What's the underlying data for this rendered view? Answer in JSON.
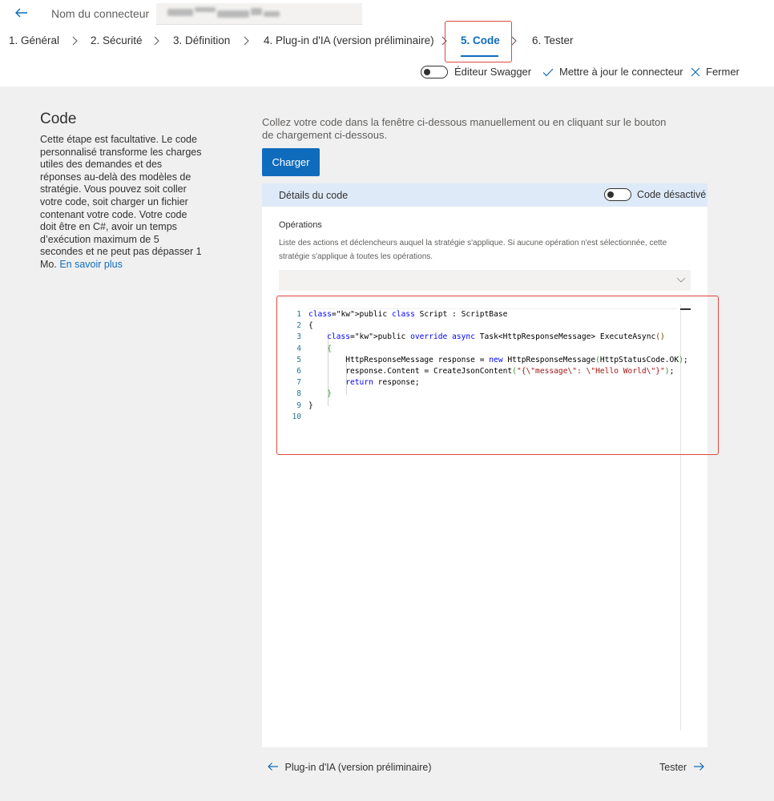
{
  "header": {
    "connector_label": "Nom du connecteur",
    "steps": [
      {
        "label": "1. Général"
      },
      {
        "label": "2. Sécurité"
      },
      {
        "label": "3. Définition"
      },
      {
        "label": "4. Plug-in d'IA (version préliminaire)"
      },
      {
        "label": "5. Code",
        "active": true
      },
      {
        "label": "6. Tester"
      }
    ],
    "actions": {
      "swagger_label": "Éditeur Swagger",
      "update_label": "Mettre à jour le connecteur",
      "close_label": "Fermer"
    }
  },
  "left": {
    "title": "Code",
    "description": "Cette étape est facultative. Le code personnalisé transforme les charges utiles des demandes et des réponses au-delà des modèles de stratégie. Vous pouvez soit coller votre code, soit charger un fichier contenant votre code. Votre code doit être en C#, avoir un temps d’exécution maximum de 5 secondes et ne peut pas dépasser 1 Mo.",
    "learn_more": "En savoir plus"
  },
  "main": {
    "intro": "Collez votre code dans la fenêtre ci-dessous manuellement ou en cliquant sur le bouton de chargement ci-dessous.",
    "upload_label": "Charger",
    "panel_title": "Détails du code",
    "code_toggle_label": "Code désactivé",
    "operations_title": "Opérations",
    "operations_desc": "Liste des actions et déclencheurs auquel la stratégie s'applique. Si aucune opération n'est sélectionnée, cette stratégie s'applique à toutes les opérations.",
    "code_lines": [
      "public class Script : ScriptBase",
      "{",
      "    public override async Task<HttpResponseMessage> ExecuteAsync()",
      "    {",
      "        HttpResponseMessage response = new HttpResponseMessage(HttpStatusCode.OK);",
      "        response.Content = CreateJsonContent(\"{\\\"message\\\": \\\"Hello World\\\"}\");",
      "        return response;",
      "    }",
      "}",
      ""
    ]
  },
  "footer": {
    "prev_label": "Plug-in d'IA (version préliminaire)",
    "next_label": "Tester"
  },
  "colors": {
    "accent": "#0f6cbd",
    "highlight": "#e0483b",
    "panel_header": "#deeaf8"
  }
}
